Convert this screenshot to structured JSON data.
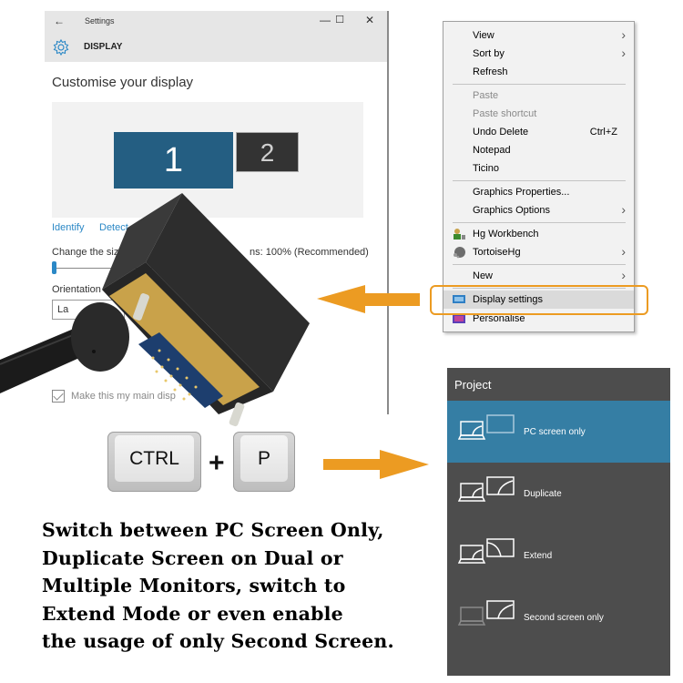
{
  "settings_window": {
    "back_icon": "back-arrow-icon",
    "title": "Settings",
    "minimize_glyph": "—",
    "maximize_glyph": "☐",
    "close_glyph": "✕",
    "section_icon": "gear-icon",
    "section": "DISPLAY",
    "heading": "Customise your display",
    "monitors": [
      {
        "label": "1",
        "selected": true
      },
      {
        "label": "2",
        "selected": false
      }
    ],
    "identify_link": "Identify",
    "detect_link": "Detect",
    "scale_label_left": "Change the size",
    "scale_label_right": "ns: 100% (Recommended)",
    "scale_percent": 100,
    "orientation_label": "Orientation",
    "orientation_value": "La",
    "main_display_checkbox": "Make this my main disp",
    "main_display_checked": true
  },
  "context_menu": {
    "items": [
      {
        "label": "View",
        "submenu": true,
        "disabled": false
      },
      {
        "label": "Sort by",
        "submenu": true,
        "disabled": false
      },
      {
        "label": "Refresh",
        "submenu": false,
        "disabled": false
      },
      {
        "label": "Paste",
        "submenu": false,
        "disabled": true
      },
      {
        "label": "Paste shortcut",
        "submenu": false,
        "disabled": true
      },
      {
        "label": "Undo Delete",
        "shortcut": "Ctrl+Z",
        "submenu": false,
        "disabled": false
      },
      {
        "label": "Notepad",
        "submenu": false,
        "disabled": false
      },
      {
        "label": "Ticino",
        "submenu": false,
        "disabled": false
      },
      {
        "label": "Graphics Properties...",
        "submenu": false,
        "disabled": false
      },
      {
        "label": "Graphics Options",
        "submenu": true,
        "disabled": false
      },
      {
        "label": "Hg Workbench",
        "icon": "hg-workbench-icon",
        "submenu": false,
        "disabled": false
      },
      {
        "label": "TortoiseHg",
        "icon": "tortoisehg-icon",
        "submenu": true,
        "disabled": false
      },
      {
        "label": "New",
        "submenu": true,
        "disabled": false
      },
      {
        "label": "Display settings",
        "icon": "display-settings-icon",
        "submenu": false,
        "disabled": false,
        "highlighted": true
      },
      {
        "label": "Personalise",
        "icon": "personalise-icon",
        "submenu": false,
        "disabled": false
      }
    ],
    "submenu_glyph": "›"
  },
  "keyboard": {
    "key1": "CTRL",
    "plus": "+",
    "key2": "P"
  },
  "caption_lines": [
    "Switch between PC Screen Only,",
    "Duplicate Screen on Dual or",
    "Multiple Monitors, switch to",
    "Extend Mode or even enable",
    "the usage of only Second Screen."
  ],
  "project_panel": {
    "title": "Project",
    "options": [
      {
        "label": "PC screen only",
        "icon": "pc-screen-only-icon",
        "active": true
      },
      {
        "label": "Duplicate",
        "icon": "duplicate-icon",
        "active": false
      },
      {
        "label": "Extend",
        "icon": "extend-icon",
        "active": false
      },
      {
        "label": "Second screen only",
        "icon": "second-screen-only-icon",
        "active": false
      }
    ]
  },
  "colors": {
    "accent_orange": "#ec9b22",
    "windows_blue": "#357ea4",
    "monitor_primary": "#245e82",
    "project_bg": "#4d4d4d"
  }
}
